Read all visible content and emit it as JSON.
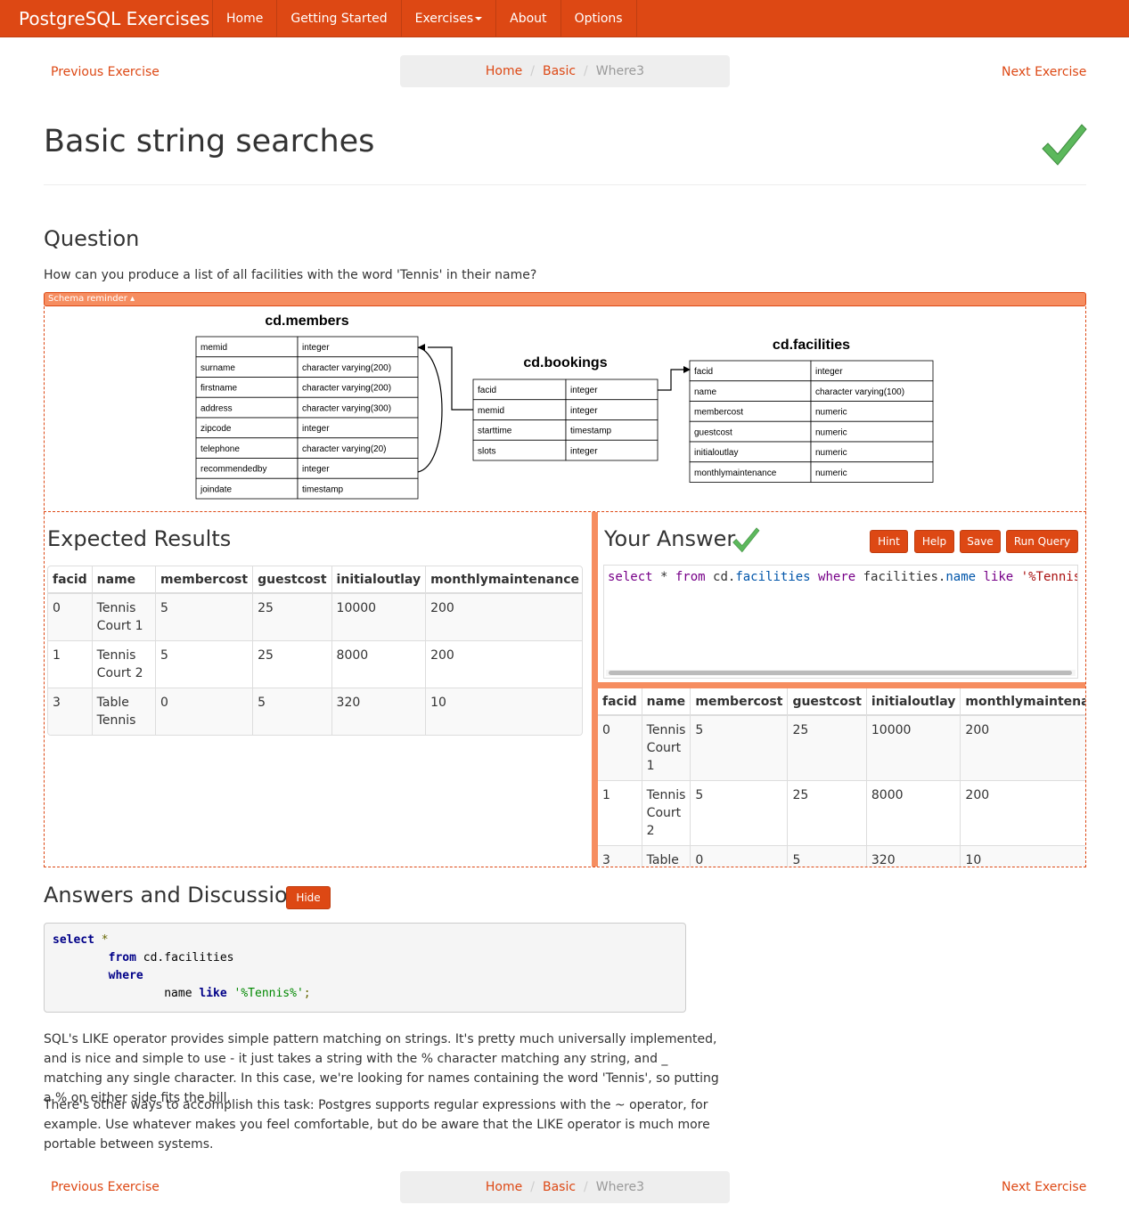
{
  "navbar": {
    "brand": "PostgreSQL Exercises",
    "items": [
      "Home",
      "Getting Started",
      "Exercises",
      "About",
      "Options"
    ]
  },
  "pager": {
    "previous": "Previous Exercise",
    "next": "Next Exercise",
    "breadcrumb": [
      "Home",
      "Basic",
      "Where3"
    ]
  },
  "page_title": "Basic string searches",
  "question": {
    "heading": "Question",
    "text": "How can you produce a list of all facilities with the word 'Tennis' in their name?"
  },
  "schema": {
    "toggle_label": "Schema reminder ▴",
    "tables": [
      {
        "name": "cd.members",
        "columns": [
          [
            "memid",
            "integer"
          ],
          [
            "surname",
            "character varying(200)"
          ],
          [
            "firstname",
            "character varying(200)"
          ],
          [
            "address",
            "character varying(300)"
          ],
          [
            "zipcode",
            "integer"
          ],
          [
            "telephone",
            "character varying(20)"
          ],
          [
            "recommendedby",
            "integer"
          ],
          [
            "joindate",
            "timestamp"
          ]
        ]
      },
      {
        "name": "cd.bookings",
        "columns": [
          [
            "facid",
            "integer"
          ],
          [
            "memid",
            "integer"
          ],
          [
            "starttime",
            "timestamp"
          ],
          [
            "slots",
            "integer"
          ]
        ]
      },
      {
        "name": "cd.facilities",
        "columns": [
          [
            "facid",
            "integer"
          ],
          [
            "name",
            "character varying(100)"
          ],
          [
            "membercost",
            "numeric"
          ],
          [
            "guestcost",
            "numeric"
          ],
          [
            "initialoutlay",
            "numeric"
          ],
          [
            "monthlymaintenance",
            "numeric"
          ]
        ]
      }
    ]
  },
  "expected": {
    "heading": "Expected Results",
    "columns": [
      "facid",
      "name",
      "membercost",
      "guestcost",
      "initialoutlay",
      "monthlymaintenance"
    ],
    "rows": [
      [
        "0",
        "Tennis Court 1",
        "5",
        "25",
        "10000",
        "200"
      ],
      [
        "1",
        "Tennis Court 2",
        "5",
        "25",
        "8000",
        "200"
      ],
      [
        "3",
        "Table Tennis",
        "0",
        "5",
        "320",
        "10"
      ]
    ]
  },
  "answer": {
    "heading": "Your Answer",
    "buttons": [
      "Hint",
      "Help",
      "Save",
      "Run Query"
    ],
    "query_tokens": {
      "t1": "select",
      "t2": " * ",
      "t3": "from",
      "t4": " cd.",
      "t5": "facilities",
      "t6": " ",
      "t7": "where",
      "t8": " facilities.",
      "t9": "name",
      "t10": " ",
      "t11": "like",
      "t12": " ",
      "t13": "'%Tennis%'",
      "t14": ";"
    },
    "results": {
      "columns": [
        "facid",
        "name",
        "membercost",
        "guestcost",
        "initialoutlay",
        "monthlymaintenance"
      ],
      "rows": [
        [
          "0",
          "Tennis Court 1",
          "5",
          "25",
          "10000",
          "200"
        ],
        [
          "1",
          "Tennis Court 2",
          "5",
          "25",
          "8000",
          "200"
        ],
        [
          "3",
          "Table Tennis",
          "0",
          "5",
          "320",
          "10"
        ]
      ]
    }
  },
  "discussion": {
    "heading": "Answers and Discussion",
    "hide_label": "Hide",
    "code": {
      "select": "select",
      "star": " *",
      "from": "from",
      "table": " cd.facilities",
      "where": "where",
      "col": "name ",
      "like": "like",
      "pattern": "'%Tennis%'",
      "semi": ";"
    },
    "paragraph1": "SQL's LIKE operator provides simple pattern matching on strings. It's pretty much universally implemented, and is nice and simple to use - it just takes a string with the % character matching any string, and _ matching any single character. In this case, we're looking for names containing the word 'Tennis', so putting a % on either side fits the bill.",
    "paragraph2": "There's other ways to accomplish this task: Postgres supports regular expressions with the ~ operator, for example. Use whatever makes you feel comfortable, but do be aware that the LIKE operator is much more portable between systems."
  },
  "colors": {
    "accent": "#dd4814",
    "accent_light": "#f68d60",
    "check": "#5cb85c",
    "breadcrumb_bg": "#eeeeee"
  },
  "icons": [
    "checkmark-icon",
    "caret-down-icon",
    "relation-arrow-icon"
  ]
}
